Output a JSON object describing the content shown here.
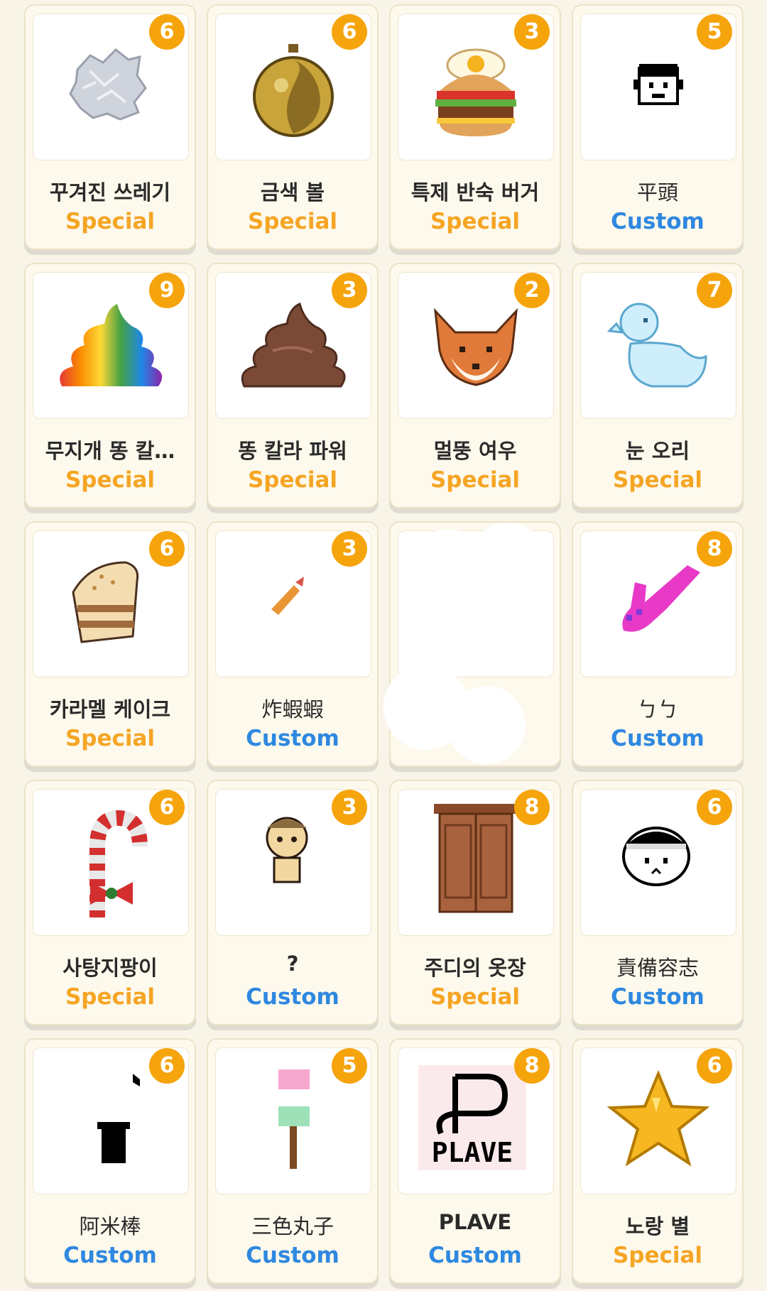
{
  "items": [
    {
      "name": "꾸겨진 쓰레기",
      "type": "Special",
      "count": "6",
      "icon": "crumpled-paper-icon"
    },
    {
      "name": "금색 볼",
      "type": "Special",
      "count": "6",
      "icon": "gold-ornament-ball-icon"
    },
    {
      "name": "특제 반숙 버거",
      "type": "Special",
      "count": "3",
      "icon": "burger-icon"
    },
    {
      "name": "平頭",
      "type": "Custom",
      "count": "5",
      "icon": "boy-face-icon"
    },
    {
      "name": "무지개 똥 칼…",
      "type": "Special",
      "count": "9",
      "icon": "rainbow-poop-icon"
    },
    {
      "name": "똥 칼라 파워",
      "type": "Special",
      "count": "3",
      "icon": "poop-icon"
    },
    {
      "name": "멀뚱 여우",
      "type": "Special",
      "count": "2",
      "icon": "fox-icon"
    },
    {
      "name": "눈 오리",
      "type": "Special",
      "count": "7",
      "icon": "snow-duck-icon"
    },
    {
      "name": "카라멜 케이크",
      "type": "Special",
      "count": "6",
      "icon": "caramel-cake-icon"
    },
    {
      "name": "炸蝦蝦",
      "type": "Custom",
      "count": "3",
      "icon": "fried-shrimp-icon"
    },
    {
      "name": "",
      "type": "",
      "count": "",
      "icon": "redacted-icon"
    },
    {
      "name": "ㄅㄅ",
      "type": "Custom",
      "count": "8",
      "icon": "pink-toy-icon"
    },
    {
      "name": "사탕지팡이",
      "type": "Special",
      "count": "6",
      "icon": "candy-cane-icon"
    },
    {
      "name": "?",
      "type": "Custom",
      "count": "3",
      "icon": "bear-doll-icon"
    },
    {
      "name": "주디의 옷장",
      "type": "Special",
      "count": "8",
      "icon": "wardrobe-icon"
    },
    {
      "name": "責備容志",
      "type": "Custom",
      "count": "6",
      "icon": "headband-face-icon"
    },
    {
      "name": "阿米棒",
      "type": "Custom",
      "count": "6",
      "icon": "black-stick-icon"
    },
    {
      "name": "三色丸子",
      "type": "Custom",
      "count": "5",
      "icon": "dango-icon"
    },
    {
      "name": "PLAVE",
      "type": "Custom",
      "count": "8",
      "icon": "plave-logo-icon"
    },
    {
      "name": "노랑 별",
      "type": "Special",
      "count": "6",
      "icon": "yellow-star-icon"
    }
  ],
  "colors": {
    "special": "#f5a524",
    "custom": "#2f88e0",
    "badge": "#f6a40c"
  }
}
